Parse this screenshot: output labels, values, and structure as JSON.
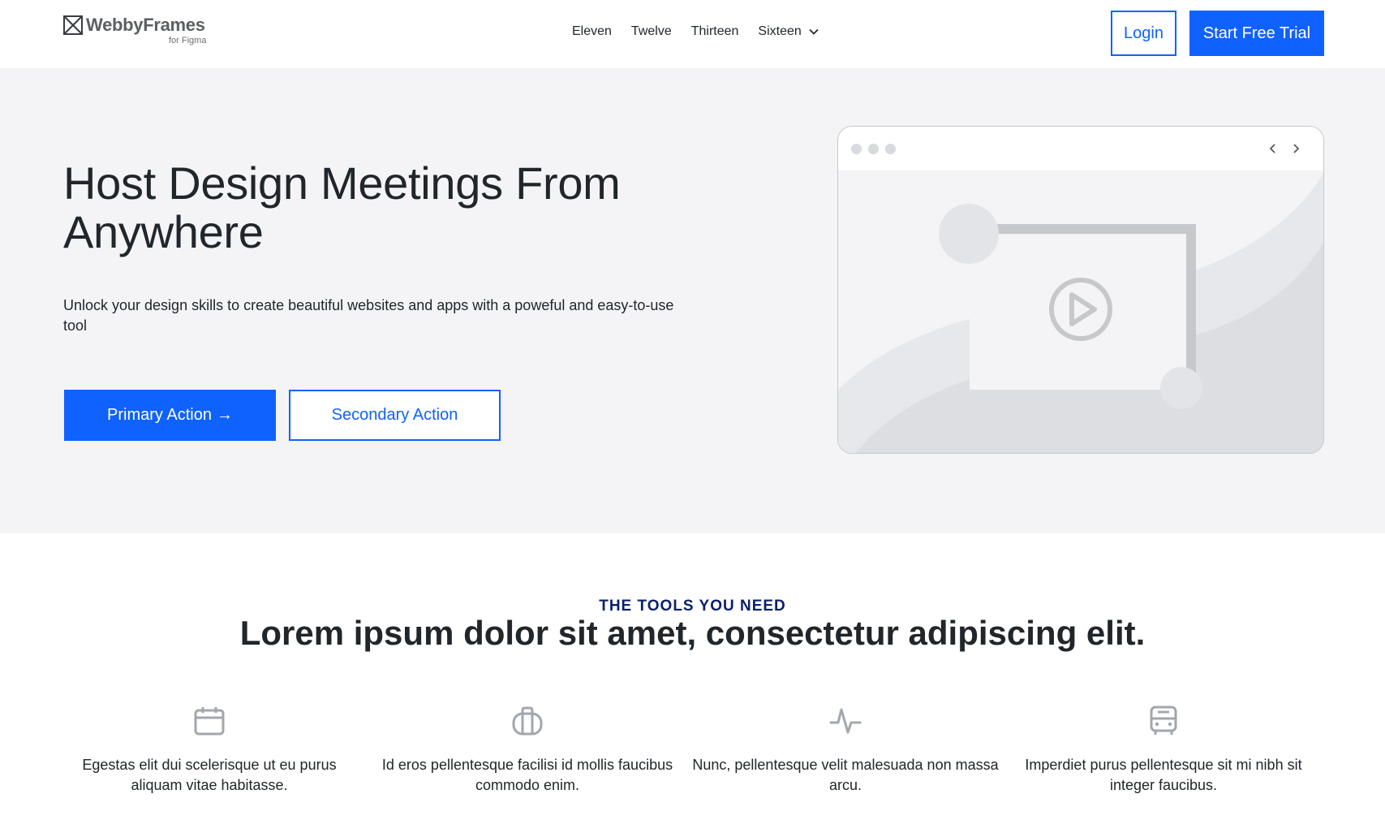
{
  "header": {
    "logo_name": "WebbyFrames",
    "logo_sub": "for Figma",
    "nav": [
      {
        "label": "Eleven"
      },
      {
        "label": "Twelve"
      },
      {
        "label": "Thirteen"
      },
      {
        "label": "Sixteen"
      }
    ],
    "login_label": "Login",
    "trial_label": "Start Free Trial"
  },
  "hero": {
    "title": "Host Design Meetings From Anywhere",
    "subtitle": "Unlock your design skills to create beautiful websites and apps with a poweful and easy-to-use tool",
    "primary_label": "Primary Action",
    "primary_arrow": "→",
    "secondary_label": "Secondary Action"
  },
  "tools": {
    "eyebrow": "THE TOOLS YOU NEED",
    "title": "Lorem ipsum dolor sit amet, consectetur adipiscing elit.",
    "features": [
      {
        "icon": "calendar-icon",
        "text": "Egestas elit dui scelerisque ut eu purus aliquam vitae habitasse."
      },
      {
        "icon": "briefcase-icon",
        "text": "Id eros pellentesque facilisi id mollis faucibus commodo enim."
      },
      {
        "icon": "activity-icon",
        "text": "Nunc, pellentesque velit malesuada non massa arcu."
      },
      {
        "icon": "bus-icon",
        "text": "Imperdiet purus pellentesque sit mi nibh sit integer faucibus."
      }
    ]
  },
  "colors": {
    "brand_blue": "#0f62fe",
    "eyebrow_navy": "#0a1f6b",
    "hero_bg": "#f4f4f7",
    "text": "#21262b",
    "muted_icon": "#a2a7ae"
  }
}
